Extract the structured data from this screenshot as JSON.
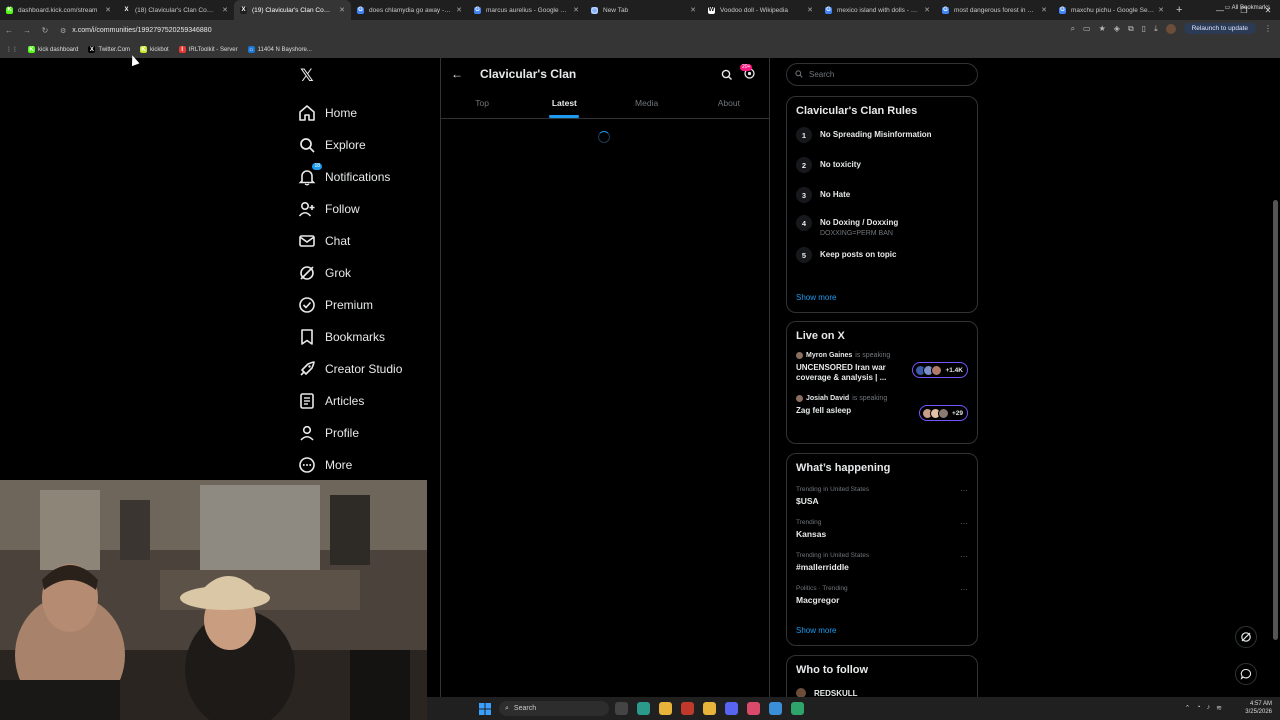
{
  "browser": {
    "tabs": [
      {
        "title": "dashboard.kick.com/stream",
        "color": "#53fc18",
        "glyph": "K"
      },
      {
        "title": "(18) Clavicular's Clan Commu...",
        "color": "#1f1f1f",
        "glyph": "X"
      },
      {
        "title": "(19) Clavicular's Clan Commu...",
        "color": "#1f1f1f",
        "glyph": "X",
        "active": true
      },
      {
        "title": "does chlamydia go away - Go...",
        "color": "#4285f4",
        "glyph": "G"
      },
      {
        "title": "marcus aurelius - Google Sear...",
        "color": "#4285f4",
        "glyph": "G"
      },
      {
        "title": "New Tab",
        "color": "#8ab4f8",
        "glyph": "◯"
      },
      {
        "title": "Voodoo doll - Wikipedia",
        "color": "#ffffff",
        "glyph": "W"
      },
      {
        "title": "mexico island with dolls - Go...",
        "color": "#4285f4",
        "glyph": "G"
      },
      {
        "title": "most dangerous forest in am...",
        "color": "#4285f4",
        "glyph": "G"
      },
      {
        "title": "maxchu pichu - Google Search",
        "color": "#4285f4",
        "glyph": "G"
      }
    ],
    "url": "x.com/i/communities/1992797520259346880",
    "relaunch_label": "Relaunch to update",
    "bookmarks": [
      {
        "label": "kick dashboard",
        "color": "#53fc18",
        "glyph": "K"
      },
      {
        "label": "Twitter.Com",
        "color": "#000000",
        "glyph": "X"
      },
      {
        "label": "kickbot",
        "color": "#c9e332",
        "glyph": "K"
      },
      {
        "label": "IRLToolkit - Server",
        "color": "#e53935",
        "glyph": "I"
      },
      {
        "label": "11404 N Bayshore...",
        "color": "#1976d2",
        "glyph": "⌂"
      }
    ],
    "all_bookmarks_label": "All Bookmarks"
  },
  "sidebar": {
    "notifications_badge": "18",
    "items": [
      {
        "label": "Home",
        "icon": "home-icon"
      },
      {
        "label": "Explore",
        "icon": "search-icon"
      },
      {
        "label": "Notifications",
        "icon": "bell-icon"
      },
      {
        "label": "Follow",
        "icon": "follow-icon"
      },
      {
        "label": "Chat",
        "icon": "mail-icon"
      },
      {
        "label": "Grok",
        "icon": "grok-icon"
      },
      {
        "label": "Premium",
        "icon": "premium-icon"
      },
      {
        "label": "Bookmarks",
        "icon": "bookmark-icon"
      },
      {
        "label": "Creator Studio",
        "icon": "rocket-icon"
      },
      {
        "label": "Articles",
        "icon": "article-icon"
      },
      {
        "label": "Profile",
        "icon": "profile-icon"
      },
      {
        "label": "More",
        "icon": "more-icon"
      }
    ]
  },
  "community": {
    "title": "Clavicular's Clan",
    "badge": "20+",
    "tabs": [
      "Top",
      "Latest",
      "Media",
      "About"
    ],
    "active_tab": "Latest"
  },
  "right": {
    "search_placeholder": "Search",
    "rules_title": "Clavicular's Clan Rules",
    "rules": [
      {
        "num": "1",
        "text": "No Spreading Misinformation",
        "sub": ""
      },
      {
        "num": "2",
        "text": "No toxicity",
        "sub": ""
      },
      {
        "num": "3",
        "text": "No Hate",
        "sub": ""
      },
      {
        "num": "4",
        "text": "No Doxing / Doxxing",
        "sub": "DOXXING=PERM BAN"
      },
      {
        "num": "5",
        "text": "Keep posts on topic",
        "sub": ""
      }
    ],
    "show_more": "Show more",
    "live_title": "Live on X",
    "live": [
      {
        "host": "Myron Gaines",
        "status": "is speaking",
        "title": "UNCENSORED Iran war coverage & analysis | ...",
        "count": "+1.4K"
      },
      {
        "host": "Josiah David",
        "status": "is speaking",
        "title": "Zag fell asleep",
        "count": "+29"
      }
    ],
    "happening_title": "What’s happening",
    "trends": [
      {
        "context": "Trending in United States",
        "name": "$USA"
      },
      {
        "context": "Trending",
        "name": "Kansas"
      },
      {
        "context": "Trending in United States",
        "name": "#mallerriddle"
      },
      {
        "context": "Politics · Trending",
        "name": "Macgregor"
      }
    ],
    "who_title": "Who to follow",
    "who_user": "REDSKULL"
  },
  "taskbar": {
    "search_label": "Search",
    "time": "4:57 AM",
    "date": "3/25/2026"
  }
}
